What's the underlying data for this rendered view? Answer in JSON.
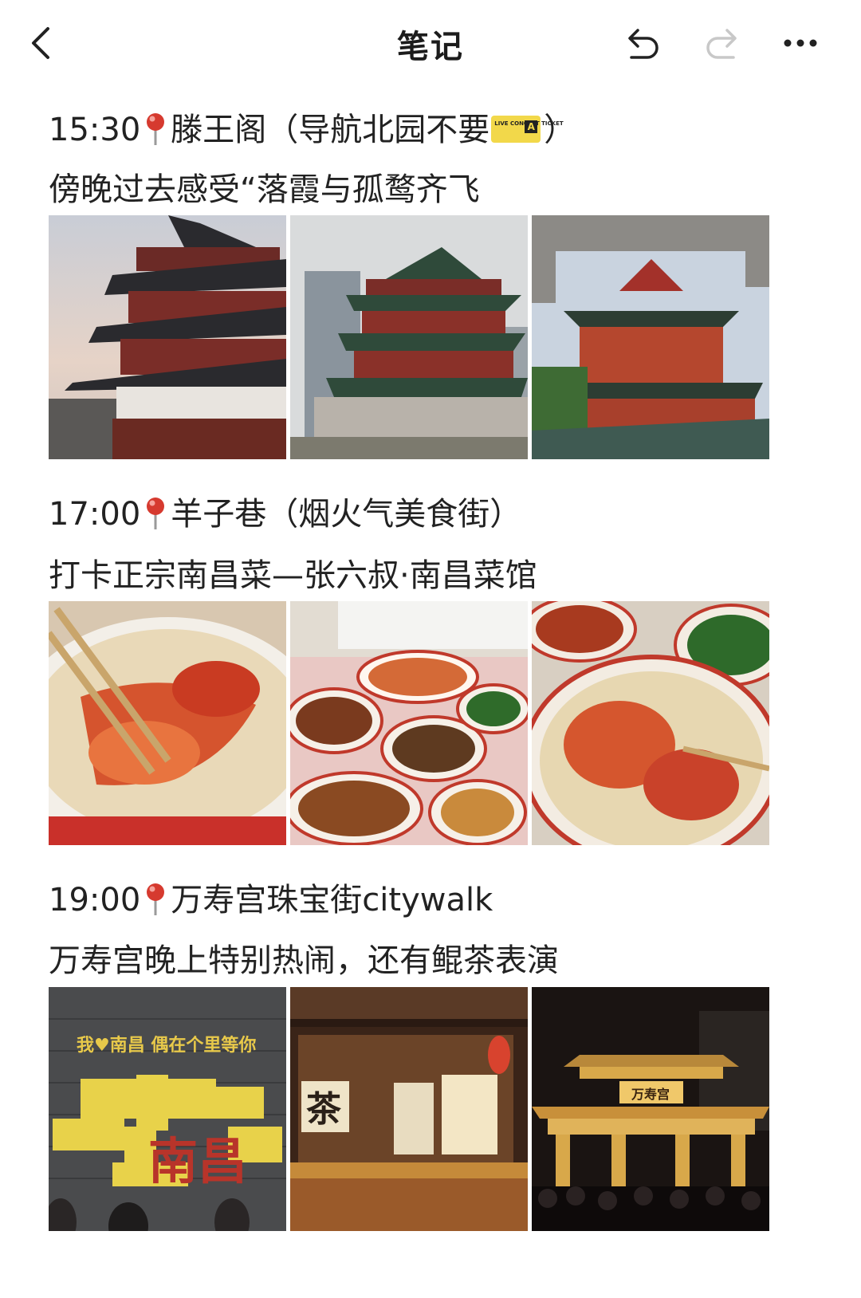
{
  "header": {
    "title": "笔记",
    "back_icon": "chevron-left-icon",
    "undo_icon": "undo-icon",
    "redo_icon": "redo-icon",
    "more_icon": "more-icon"
  },
  "sections": [
    {
      "time": "15:30",
      "place": "滕王阁（导航北园不要",
      "place_suffix": "）",
      "ticket_text": "LIVE CONCERT TICKET",
      "ticket_letter": "A",
      "note": "傍晚过去感受“落霞与孤鹜齐飞"
    },
    {
      "time": "17:00",
      "place": "羊子巷（烟火气美食街）",
      "note": "打卡正宗南昌菜—张六叔·南昌菜馆"
    },
    {
      "time": "19:00",
      "place": "万寿宫珠宝街citywalk",
      "note": "万寿宫晚上特别热闹，还有鲲茶表演",
      "photo_texts": {
        "wall_slogan": "我♥南昌 偶在个里等你",
        "wall_big": "南昌",
        "sign_tea": "茶",
        "gate_plaque": "万寿宫"
      }
    }
  ],
  "colors": {
    "pin": "#d63a2f",
    "text": "#222222",
    "icon_disabled": "#c8c8c8"
  }
}
